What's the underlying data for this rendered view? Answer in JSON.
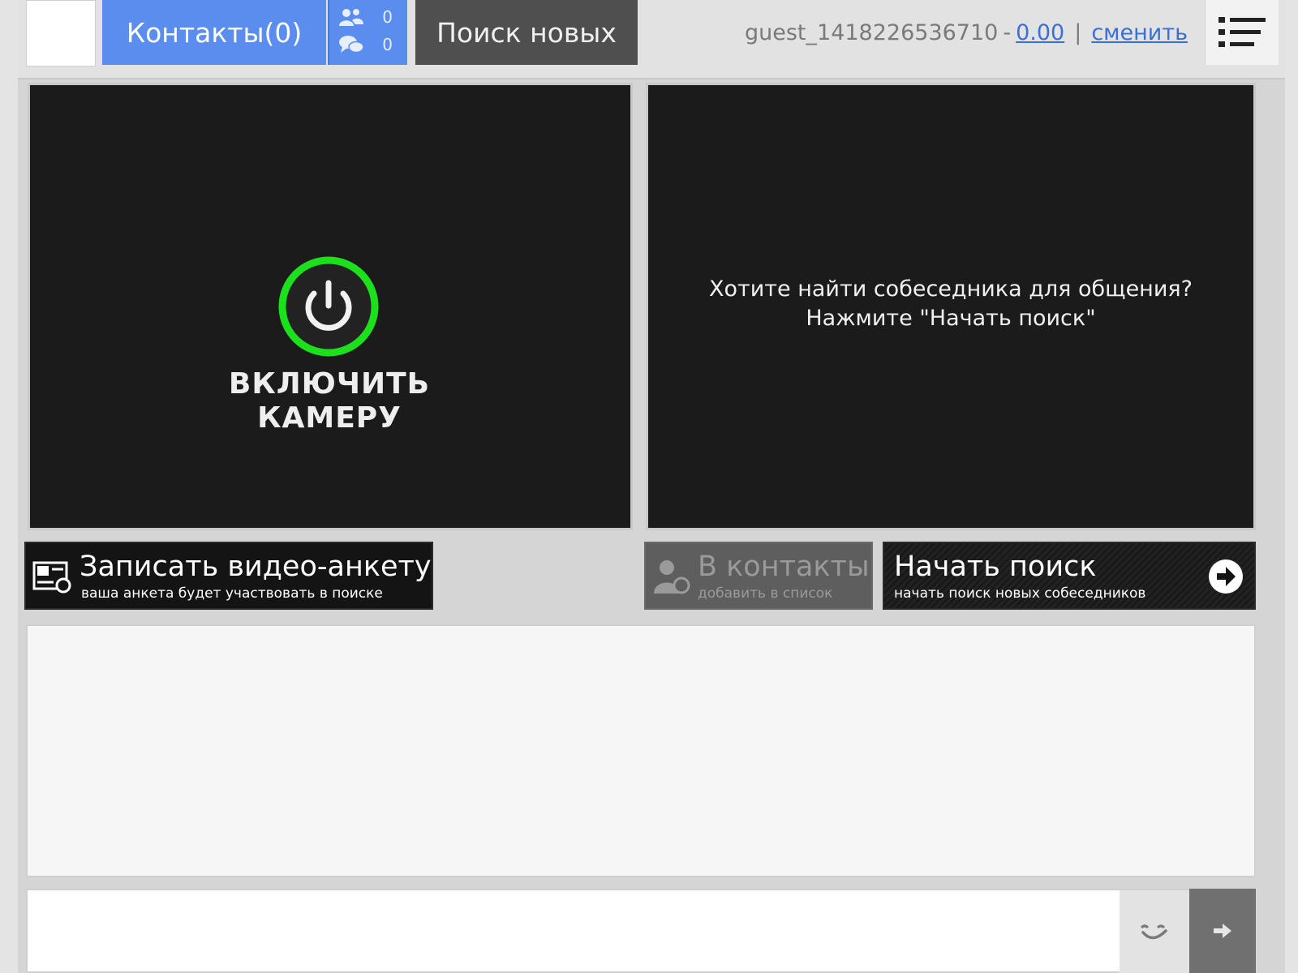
{
  "topbar": {
    "contacts_label": "Контакты(0)",
    "contacts_online_count": "0",
    "messages_count": "0",
    "search_new_label": "Поиск новых",
    "user": {
      "name": "guest_1418226536710",
      "dash": "-",
      "balance": "0.00",
      "separator": "|",
      "change_label": "сменить"
    }
  },
  "local_video": {
    "enable_camera_line1": "ВКЛЮЧИТЬ",
    "enable_camera_line2": "КАМЕРУ"
  },
  "remote_video": {
    "message_line1": "Хотите найти собеседника для общения?",
    "message_line2": "Нажмите \"Начать поиск\""
  },
  "actions": {
    "record": {
      "title": "Записать видео-анкету",
      "subtitle": "ваша анкета будет участвовать в поиске"
    },
    "add_contact": {
      "title": "В контакты",
      "subtitle": "добавить в список"
    },
    "start_search": {
      "title": "Начать поиск",
      "subtitle": "начать поиск новых собеседников"
    }
  },
  "chat": {
    "input_value": "",
    "input_placeholder": ""
  },
  "colors": {
    "accent_blue": "#5b8def",
    "power_ring_green": "#1de01d",
    "panel_bg": "#1b1b1b"
  }
}
